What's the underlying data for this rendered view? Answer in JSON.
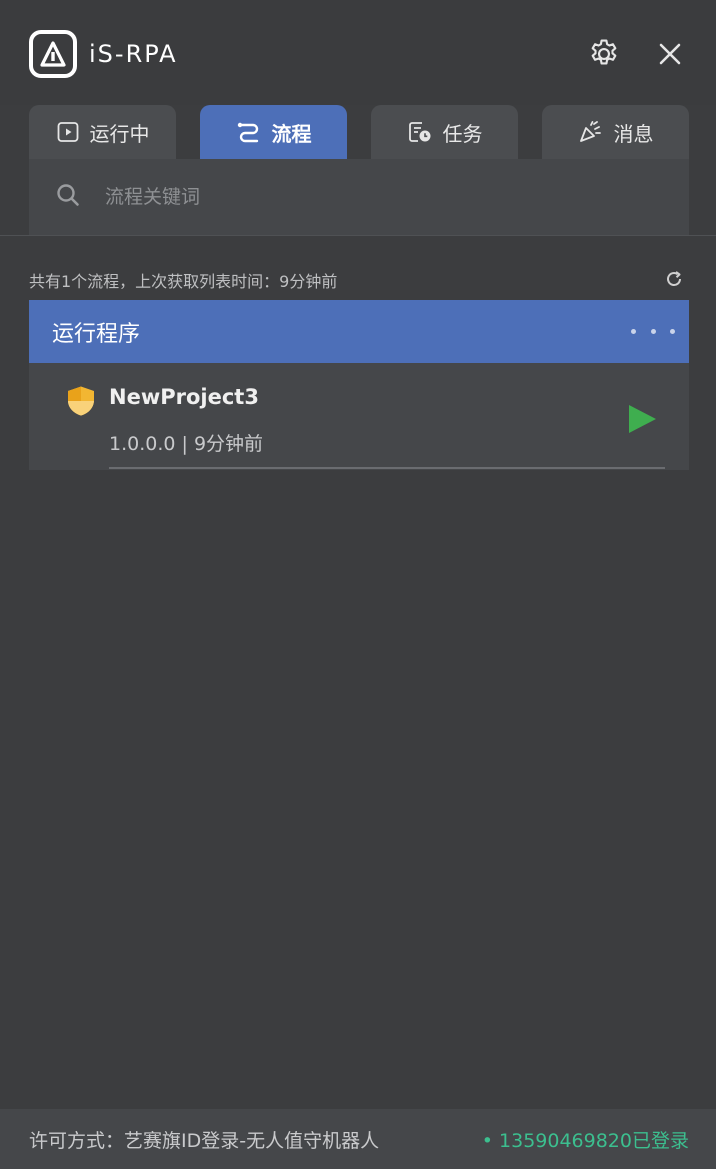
{
  "app": {
    "name": "iS-RPA"
  },
  "tabs": [
    {
      "label": "运行中",
      "icon": "play-box-icon"
    },
    {
      "label": "流程",
      "icon": "flow-icon"
    },
    {
      "label": "任务",
      "icon": "task-clock-icon"
    },
    {
      "label": "消息",
      "icon": "party-icon"
    }
  ],
  "active_tab": "流程",
  "search": {
    "placeholder": "流程关键词",
    "value": ""
  },
  "summary": "共有1个流程，上次获取列表时间：9分钟前",
  "group": {
    "title": "运行程序"
  },
  "process": {
    "name": "NewProject3",
    "meta": "1.0.0.0 | 9分钟前"
  },
  "footer": {
    "license": "许可方式：艺赛旗ID登录-无人值守机器人",
    "status": "• 13590469820已登录"
  },
  "colors": {
    "accent": "#4d6fb8",
    "play": "#3fae4f",
    "shield": "#f2b632",
    "status": "#3cbf8f"
  }
}
